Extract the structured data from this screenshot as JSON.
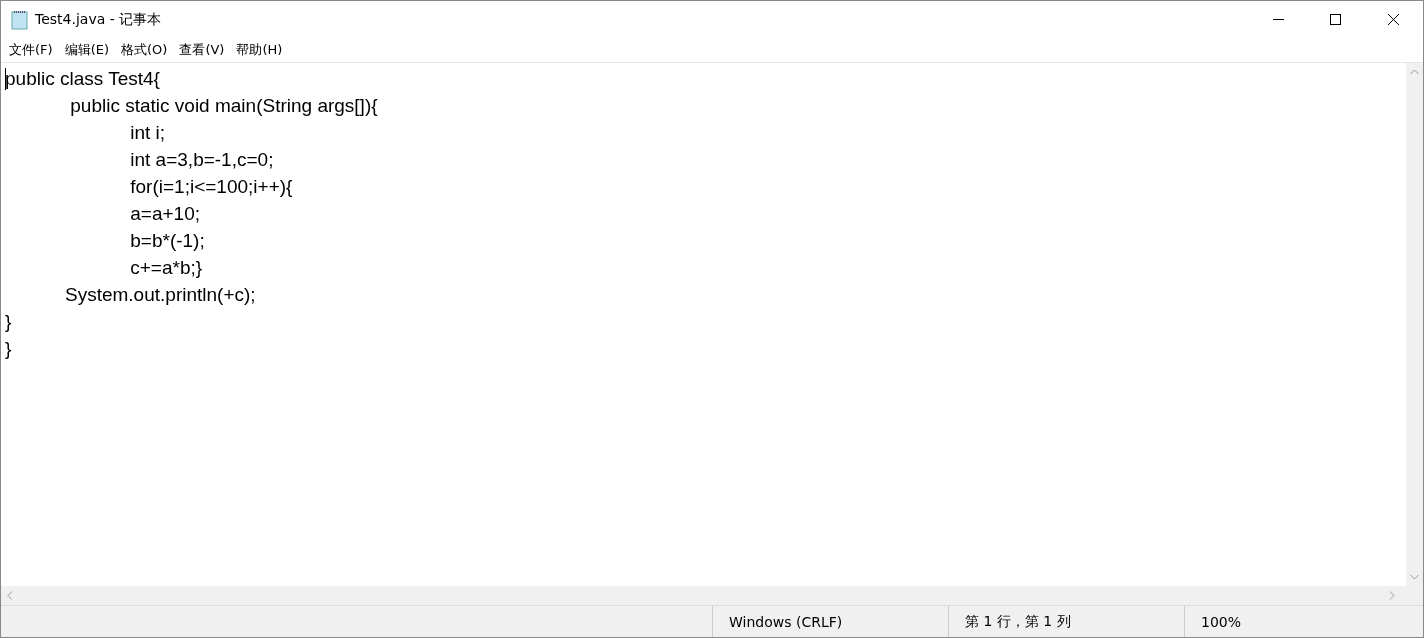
{
  "window": {
    "title": "Test4.java - 记事本"
  },
  "menu": [
    {
      "label": "文件(F)"
    },
    {
      "label": "编辑(E)"
    },
    {
      "label": "格式(O)"
    },
    {
      "label": "查看(V)"
    },
    {
      "label": "帮助(H)"
    }
  ],
  "editor": {
    "lines": [
      "public class Test4{",
      "\t public static void main(String args[]){",
      "\t\t int i;",
      "\t\t int a=3,b=-1,c=0;",
      "\t\t for(i=1;i<=100;i++){",
      "\t\t a=a+10;",
      "\t\t b=b*(-1);",
      "\t\t c+=a*b;}",
      "\tSystem.out.println(+c);",
      "}",
      "}"
    ]
  },
  "status_bar": {
    "line_ending": "Windows (CRLF)",
    "position": "第 1 行，第 1 列",
    "zoom": "100%"
  }
}
